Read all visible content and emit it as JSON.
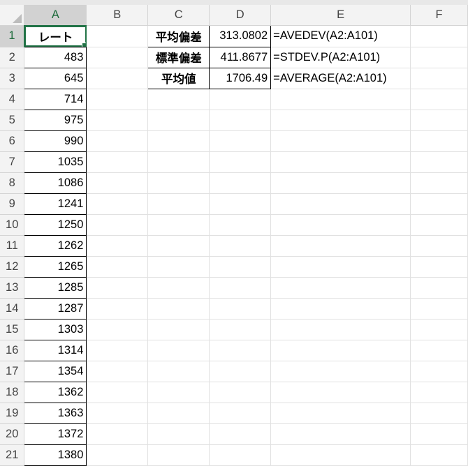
{
  "columns": [
    "A",
    "B",
    "C",
    "D",
    "E",
    "F"
  ],
  "selected_cell": {
    "column": "A",
    "row": 1
  },
  "rows": [
    {
      "num": "1",
      "A": "レート",
      "C": "平均偏差",
      "D": "313.0802",
      "E": "=AVEDEV(A2:A101)"
    },
    {
      "num": "2",
      "A": "483",
      "C": "標準偏差",
      "D": "411.8677",
      "E": "=STDEV.P(A2:A101)"
    },
    {
      "num": "3",
      "A": "645",
      "C": "平均値",
      "D": "1706.49",
      "E": "=AVERAGE(A2:A101)"
    },
    {
      "num": "4",
      "A": "714"
    },
    {
      "num": "5",
      "A": "975"
    },
    {
      "num": "6",
      "A": "990"
    },
    {
      "num": "7",
      "A": "1035"
    },
    {
      "num": "8",
      "A": "1086"
    },
    {
      "num": "9",
      "A": "1241"
    },
    {
      "num": "10",
      "A": "1250"
    },
    {
      "num": "11",
      "A": "1262"
    },
    {
      "num": "12",
      "A": "1265"
    },
    {
      "num": "13",
      "A": "1285"
    },
    {
      "num": "14",
      "A": "1287"
    },
    {
      "num": "15",
      "A": "1303"
    },
    {
      "num": "16",
      "A": "1314"
    },
    {
      "num": "17",
      "A": "1354"
    },
    {
      "num": "18",
      "A": "1362"
    },
    {
      "num": "19",
      "A": "1363"
    },
    {
      "num": "20",
      "A": "1372"
    },
    {
      "num": "21",
      "A": "1380"
    }
  ]
}
